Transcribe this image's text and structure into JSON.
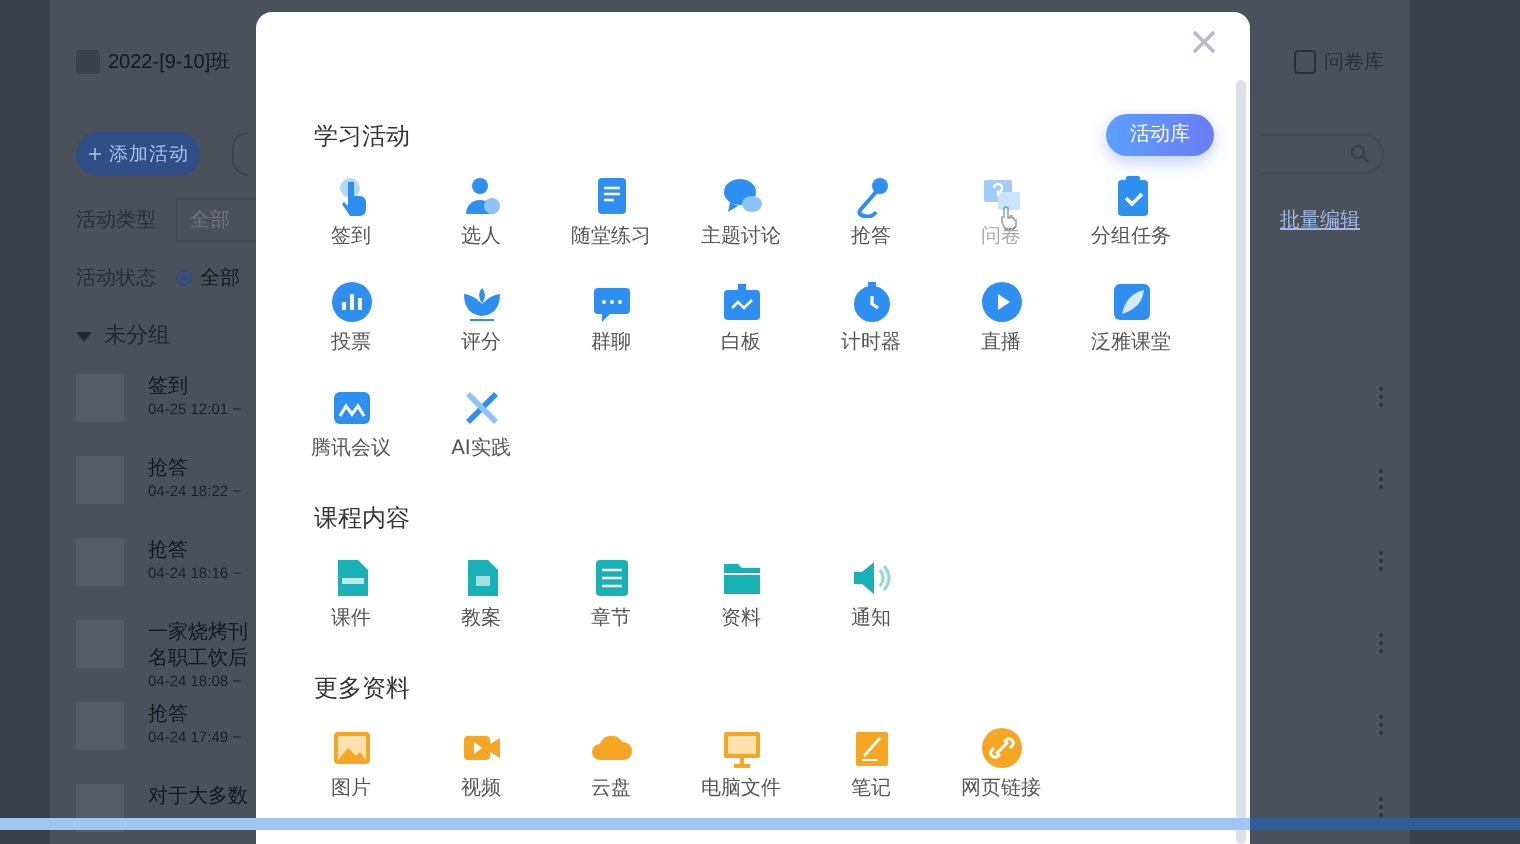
{
  "page": {
    "title": "2022-[9-10]班",
    "survey_library": "问卷库",
    "add_button": "+ 添加活动",
    "type_label": "活动类型",
    "type_field": {
      "placeholder": "全部"
    },
    "status_label": "活动状态",
    "status_options": [
      {
        "label": "全部",
        "selected": true
      }
    ],
    "batch_edit": "批量编辑",
    "group": {
      "label": "未分组",
      "expanded": true
    },
    "activities": [
      {
        "title": "签到",
        "time": "04-25 12:01 ~"
      },
      {
        "title": "抢答",
        "time": "04-24 18:22 ~"
      },
      {
        "title": "抢答",
        "time": "04-24 18:16 ~"
      },
      {
        "title": "一家烧烤刊名职工饮后",
        "time": "04-24 18:08 ~"
      },
      {
        "title": "抢答",
        "time": "04-24 17:49 ~"
      },
      {
        "title": "对于大多数"
      }
    ]
  },
  "modal": {
    "library_button": "活动库",
    "sections": [
      {
        "title": "学习活动",
        "kind": "activity",
        "items": [
          {
            "label": "签到",
            "kind": "hand",
            "hovered": false
          },
          {
            "label": "选人",
            "kind": "person",
            "hovered": false
          },
          {
            "label": "随堂练习",
            "kind": "doc",
            "hovered": false
          },
          {
            "label": "主题讨论",
            "kind": "chat",
            "hovered": false
          },
          {
            "label": "抢答",
            "kind": "mic",
            "hovered": false
          },
          {
            "label": "问卷",
            "kind": "question",
            "hovered": true
          },
          {
            "label": "分组任务",
            "kind": "clipboard",
            "hovered": false
          },
          {
            "label": "投票",
            "kind": "chart",
            "hovered": false
          },
          {
            "label": "评分",
            "kind": "lotus",
            "hovered": false
          },
          {
            "label": "群聊",
            "kind": "message",
            "hovered": false
          },
          {
            "label": "白板",
            "kind": "board",
            "hovered": false
          },
          {
            "label": "计时器",
            "kind": "timer",
            "hovered": false
          },
          {
            "label": "直播",
            "kind": "play",
            "hovered": false
          },
          {
            "label": "泛雅课堂",
            "kind": "leaf",
            "hovered": false
          },
          {
            "label": "腾讯会议",
            "kind": "meeting",
            "hovered": false
          },
          {
            "label": "AI实践",
            "kind": "tools",
            "hovered": false
          }
        ]
      },
      {
        "title": "课程内容",
        "kind": "content",
        "items": [
          {
            "label": "课件",
            "kind": "ppt",
            "hovered": false
          },
          {
            "label": "教案",
            "kind": "file",
            "hovered": false
          },
          {
            "label": "章节",
            "kind": "list",
            "hovered": false
          },
          {
            "label": "资料",
            "kind": "folder",
            "hovered": false
          },
          {
            "label": "通知",
            "kind": "speaker",
            "hovered": false
          }
        ]
      },
      {
        "title": "更多资料",
        "kind": "material",
        "items": [
          {
            "label": "图片",
            "kind": "image",
            "hovered": false
          },
          {
            "label": "视频",
            "kind": "video",
            "hovered": false
          },
          {
            "label": "云盘",
            "kind": "cloud",
            "hovered": false
          },
          {
            "label": "电脑文件",
            "kind": "monitor",
            "hovered": false
          },
          {
            "label": "笔记",
            "kind": "note",
            "hovered": false
          },
          {
            "label": "网页链接",
            "kind": "link",
            "hovered": false
          }
        ]
      }
    ]
  }
}
